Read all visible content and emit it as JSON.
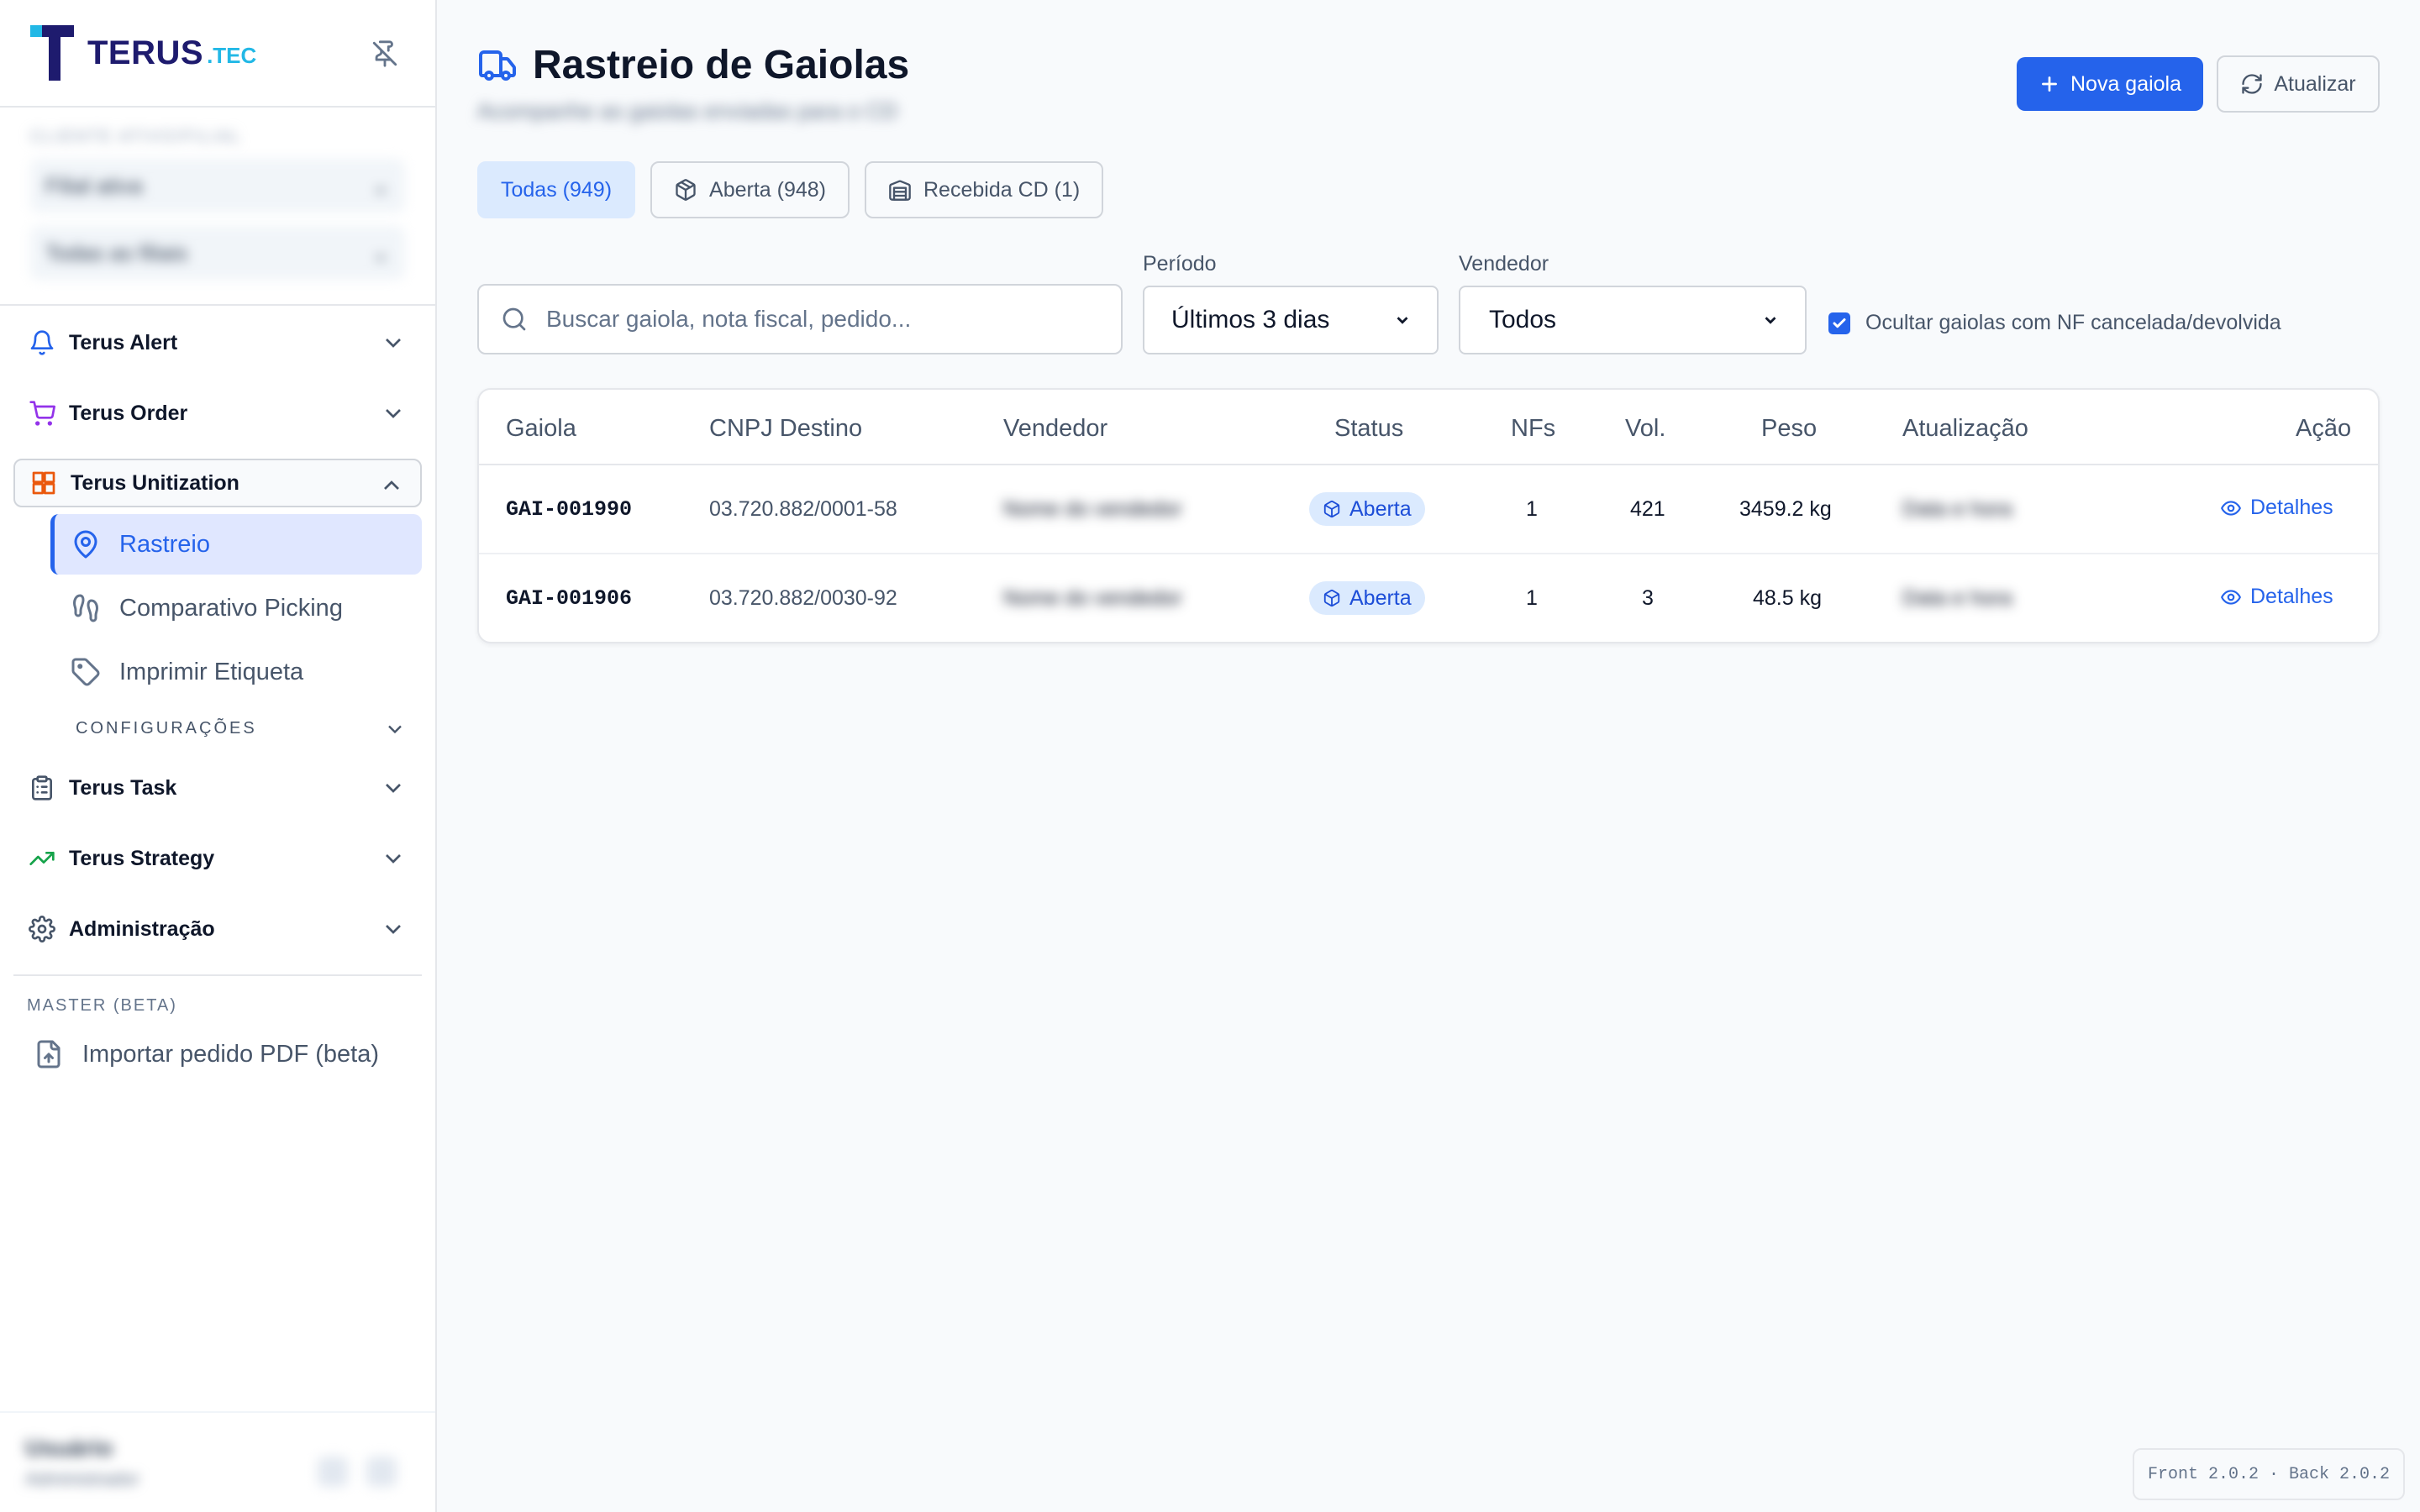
{
  "app": {
    "logo_text": "TERUS",
    "logo_suffix": ".TEC"
  },
  "sidebar": {
    "context_label": "CLIENTE ATIVO/FILIAL",
    "company_select": "Filial ativa",
    "branch_select": "Todas as filiais",
    "nav": [
      {
        "label": "Terus Alert",
        "icon": "bell-icon"
      },
      {
        "label": "Terus Order",
        "icon": "cart-icon"
      },
      {
        "label": "Terus Unitization",
        "icon": "grid-icon"
      }
    ],
    "sub_items": [
      {
        "label": "Rastreio",
        "icon": "map-pin-icon"
      },
      {
        "label": "Comparativo Picking",
        "icon": "footprints-icon"
      },
      {
        "label": "Imprimir Etiqueta",
        "icon": "tag-icon"
      }
    ],
    "config_label": "CONFIGURAÇÕES",
    "nav_bottom": [
      {
        "label": "Terus Task",
        "icon": "clipboard-icon"
      },
      {
        "label": "Terus Strategy",
        "icon": "trending-up-icon"
      },
      {
        "label": "Administração",
        "icon": "gear-icon"
      }
    ],
    "master_label": "MASTER (BETA)",
    "import_label": "Importar pedido PDF (beta)",
    "user": {
      "name": "Usuário",
      "role": "Administrador"
    }
  },
  "header": {
    "title": "Rastreio de Gaiolas",
    "subtitle": "Acompanhe as gaiolas enviadas para o CD",
    "new_button": "Nova gaiola",
    "refresh_button": "Atualizar"
  },
  "tabs": [
    {
      "label": "Todas (949)"
    },
    {
      "label": "Aberta (948)"
    },
    {
      "label": "Recebida CD (1)"
    }
  ],
  "filters": {
    "search_placeholder": "Buscar gaiola, nota fiscal, pedido...",
    "period_label": "Período",
    "period_value": "Últimos 3 dias",
    "seller_label": "Vendedor",
    "seller_value": "Todos",
    "hide_cancelled_label": "Ocultar gaiolas com NF cancelada/devolvida",
    "hide_cancelled_checked": true
  },
  "table": {
    "columns": [
      "Gaiola",
      "CNPJ Destino",
      "Vendedor",
      "Status",
      "NFs",
      "Vol.",
      "Peso",
      "Atualização",
      "Ação"
    ],
    "rows": [
      {
        "gaiola": "GAI-001990",
        "cnpj": "03.720.882/0001-58",
        "vendedor": "Nome do vendedor",
        "status": "Aberta",
        "nfs": "1",
        "vol": "421",
        "peso": "3459.2 kg",
        "atualizacao": "Data e hora",
        "acao": "Detalhes"
      },
      {
        "gaiola": "GAI-001906",
        "cnpj": "03.720.882/0030-92",
        "vendedor": "Nome do vendedor",
        "status": "Aberta",
        "nfs": "1",
        "vol": "3",
        "peso": "48.5 kg",
        "atualizacao": "Data e hora",
        "acao": "Detalhes"
      }
    ]
  },
  "footer": {
    "version": "Front 2.0.2 · Back 2.0.2"
  },
  "colors": {
    "primary": "#2563eb",
    "badge_bg": "#dbeafe",
    "sidebar_active_bg": "#e0e7ff",
    "border": "#e5e7eb"
  }
}
